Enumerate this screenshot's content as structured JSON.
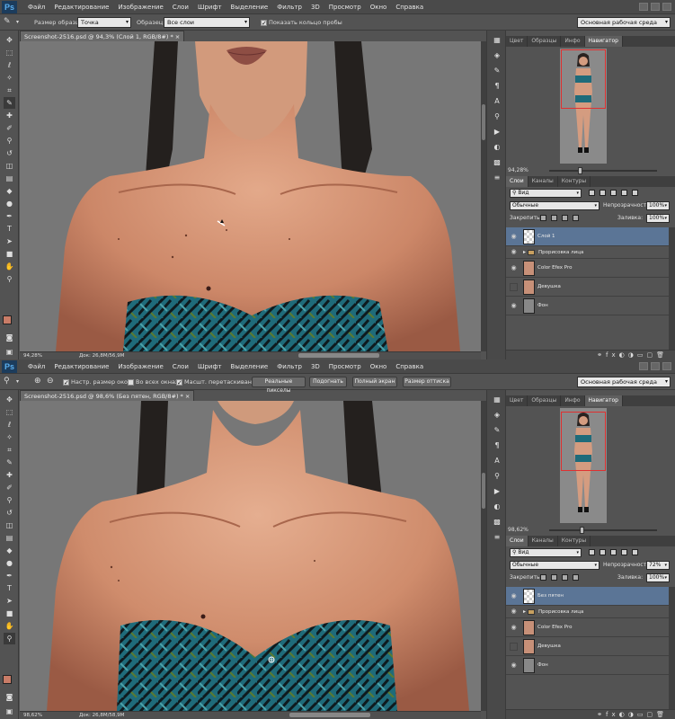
{
  "app": {
    "logo": "Ps",
    "menu": [
      "Файл",
      "Редактирование",
      "Изображение",
      "Слои",
      "Шрифт",
      "Выделение",
      "Фильтр",
      "3D",
      "Просмотр",
      "Окно",
      "Справка"
    ],
    "workspace": "Основная рабочая среда"
  },
  "window1": {
    "options": {
      "sample_size_label": "Размер образца:",
      "sample_size_value": "Точка",
      "sample_label": "Образец:",
      "sample_value": "Все слои",
      "show_ring_label": "Показать кольцо пробы"
    },
    "doc_tab": "Screenshot-2516.psd @ 94,3% (Слой 1, RGB/8#) *",
    "status_zoom": "94,28%",
    "status_doc": "Док: 26,8M/56,9M",
    "panel_tabs": [
      "Цвет",
      "Образцы",
      "Инфо",
      "Навигатор"
    ],
    "nav_zoom": "94,28%",
    "layers_tabs": [
      "Слои",
      "Каналы",
      "Контуры"
    ],
    "filter_value": "Вид",
    "blend_mode": "Обычные",
    "opacity_label": "Непрозрачность:",
    "opacity_value": "100%",
    "lock_label": "Закрепить:",
    "fill_label": "Заливка:",
    "fill_value": "100%",
    "layers": [
      "Слой 1",
      "Прорисовка лица",
      "Color Efex Pro",
      "Девушка",
      "Фон"
    ],
    "selected_layer": 0
  },
  "window2": {
    "options": {
      "resize_windows_label": "Настр. размер окон",
      "all_windows_label": "Во всех окнах",
      "scrubby_zoom_label": "Масшт. перетаскиванием",
      "btn_actual": "Реальные пикселы",
      "btn_fit": "Подогнать",
      "btn_fill": "Полный экран",
      "btn_print": "Размер оттиска"
    },
    "doc_tab": "Screenshot-2516.psd @ 98,6% (Без пятен, RGB/8#) *",
    "status_zoom": "98,62%",
    "status_doc": "Док: 26,8M/58,9M",
    "panel_tabs": [
      "Цвет",
      "Образцы",
      "Инфо",
      "Навигатор"
    ],
    "nav_zoom": "98,62%",
    "layers_tabs": [
      "Слои",
      "Каналы",
      "Контуры"
    ],
    "filter_value": "Вид",
    "blend_mode": "Обычные",
    "opacity_label": "Непрозрачность:",
    "opacity_value": "72%",
    "lock_label": "Закрепить:",
    "fill_label": "Заливка:",
    "fill_value": "100%",
    "layers": [
      "Без пятен",
      "Прорисовка лица",
      "Color Efex Pro",
      "Девушка",
      "Фон"
    ],
    "selected_layer": 0
  },
  "colors": {
    "foreground": "#c97c67",
    "background": "#f0e6e0",
    "selected_layer": "#5b7596"
  }
}
